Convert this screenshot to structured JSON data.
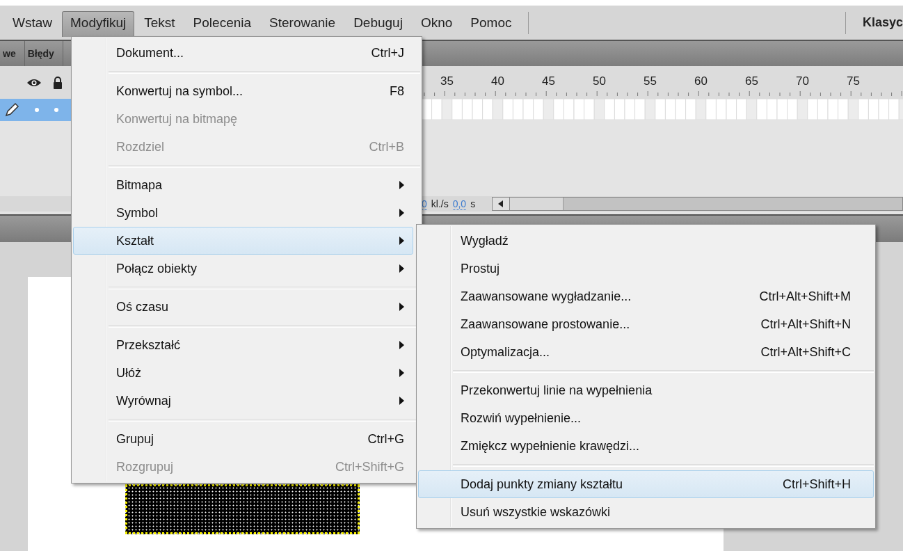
{
  "menubar": {
    "items": [
      {
        "label": "Wstaw",
        "selected": false
      },
      {
        "label": "Modyfikuj",
        "selected": true
      },
      {
        "label": "Tekst",
        "selected": false
      },
      {
        "label": "Polecenia",
        "selected": false
      },
      {
        "label": "Sterowanie",
        "selected": false
      },
      {
        "label": "Debuguj",
        "selected": false
      },
      {
        "label": "Okno",
        "selected": false
      },
      {
        "label": "Pomoc",
        "selected": false
      }
    ],
    "workspace": "Klasyc"
  },
  "panel_tabs": [
    "we",
    "Błędy"
  ],
  "timeline": {
    "ruler": [
      "35",
      "40",
      "45",
      "50",
      "55",
      "60",
      "65",
      "70",
      "75"
    ],
    "layer": {
      "selected": true
    },
    "fps": {
      "value": "0",
      "unit": "kl./s"
    },
    "time": {
      "value": "0,0",
      "unit": "s"
    }
  },
  "menu": {
    "items": [
      {
        "kind": "item",
        "label": "Dokument...",
        "shortcut": "Ctrl+J",
        "disabled": false,
        "submenu": false,
        "selected": false
      },
      {
        "kind": "separator"
      },
      {
        "kind": "item",
        "label": "Konwertuj na symbol...",
        "shortcut": "F8",
        "disabled": false,
        "submenu": false,
        "selected": false
      },
      {
        "kind": "item",
        "label": "Konwertuj na bitmapę",
        "disabled": true,
        "submenu": false,
        "selected": false
      },
      {
        "kind": "item",
        "label": "Rozdziel",
        "shortcut": "Ctrl+B",
        "disabled": true,
        "submenu": false,
        "selected": false
      },
      {
        "kind": "separator"
      },
      {
        "kind": "item",
        "label": "Bitmapa",
        "disabled": false,
        "submenu": true,
        "selected": false
      },
      {
        "kind": "item",
        "label": "Symbol",
        "disabled": false,
        "submenu": true,
        "selected": false
      },
      {
        "kind": "item",
        "label": "Kształt",
        "disabled": false,
        "submenu": true,
        "selected": true
      },
      {
        "kind": "item",
        "label": "Połącz obiekty",
        "disabled": false,
        "submenu": true,
        "selected": false
      },
      {
        "kind": "separator"
      },
      {
        "kind": "item",
        "label": "Oś czasu",
        "disabled": false,
        "submenu": true,
        "selected": false
      },
      {
        "kind": "separator"
      },
      {
        "kind": "item",
        "label": "Przekształć",
        "disabled": false,
        "submenu": true,
        "selected": false
      },
      {
        "kind": "item",
        "label": "Ułóż",
        "disabled": false,
        "submenu": true,
        "selected": false
      },
      {
        "kind": "item",
        "label": "Wyrównaj",
        "disabled": false,
        "submenu": true,
        "selected": false
      },
      {
        "kind": "separator"
      },
      {
        "kind": "item",
        "label": "Grupuj",
        "shortcut": "Ctrl+G",
        "disabled": false,
        "submenu": false,
        "selected": false
      },
      {
        "kind": "item",
        "label": "Rozgrupuj",
        "shortcut": "Ctrl+Shift+G",
        "disabled": true,
        "submenu": false,
        "selected": false
      }
    ]
  },
  "submenu": {
    "items": [
      {
        "kind": "item",
        "label": "Wygładź",
        "disabled": false,
        "submenu": false,
        "selected": false
      },
      {
        "kind": "item",
        "label": "Prostuj",
        "disabled": false,
        "submenu": false,
        "selected": false
      },
      {
        "kind": "item",
        "label": "Zaawansowane wygładzanie...",
        "shortcut": "Ctrl+Alt+Shift+M",
        "disabled": false,
        "submenu": false,
        "selected": false
      },
      {
        "kind": "item",
        "label": "Zaawansowane prostowanie...",
        "shortcut": "Ctrl+Alt+Shift+N",
        "disabled": false,
        "submenu": false,
        "selected": false
      },
      {
        "kind": "item",
        "label": "Optymalizacja...",
        "shortcut": "Ctrl+Alt+Shift+C",
        "disabled": false,
        "submenu": false,
        "selected": false
      },
      {
        "kind": "separator"
      },
      {
        "kind": "item",
        "label": "Przekonwertuj linie na wypełnienia",
        "disabled": false,
        "submenu": false,
        "selected": false
      },
      {
        "kind": "item",
        "label": "Rozwiń wypełnienie...",
        "disabled": false,
        "submenu": false,
        "selected": false
      },
      {
        "kind": "item",
        "label": "Zmiękcz wypełnienie krawędzi...",
        "disabled": false,
        "submenu": false,
        "selected": false
      },
      {
        "kind": "separator"
      },
      {
        "kind": "item",
        "label": "Dodaj punkty zmiany kształtu",
        "shortcut": "Ctrl+Shift+H",
        "disabled": false,
        "submenu": false,
        "selected": true
      },
      {
        "kind": "item",
        "label": "Usuń wszystkie wskazówki",
        "disabled": false,
        "submenu": false,
        "selected": false
      }
    ]
  }
}
